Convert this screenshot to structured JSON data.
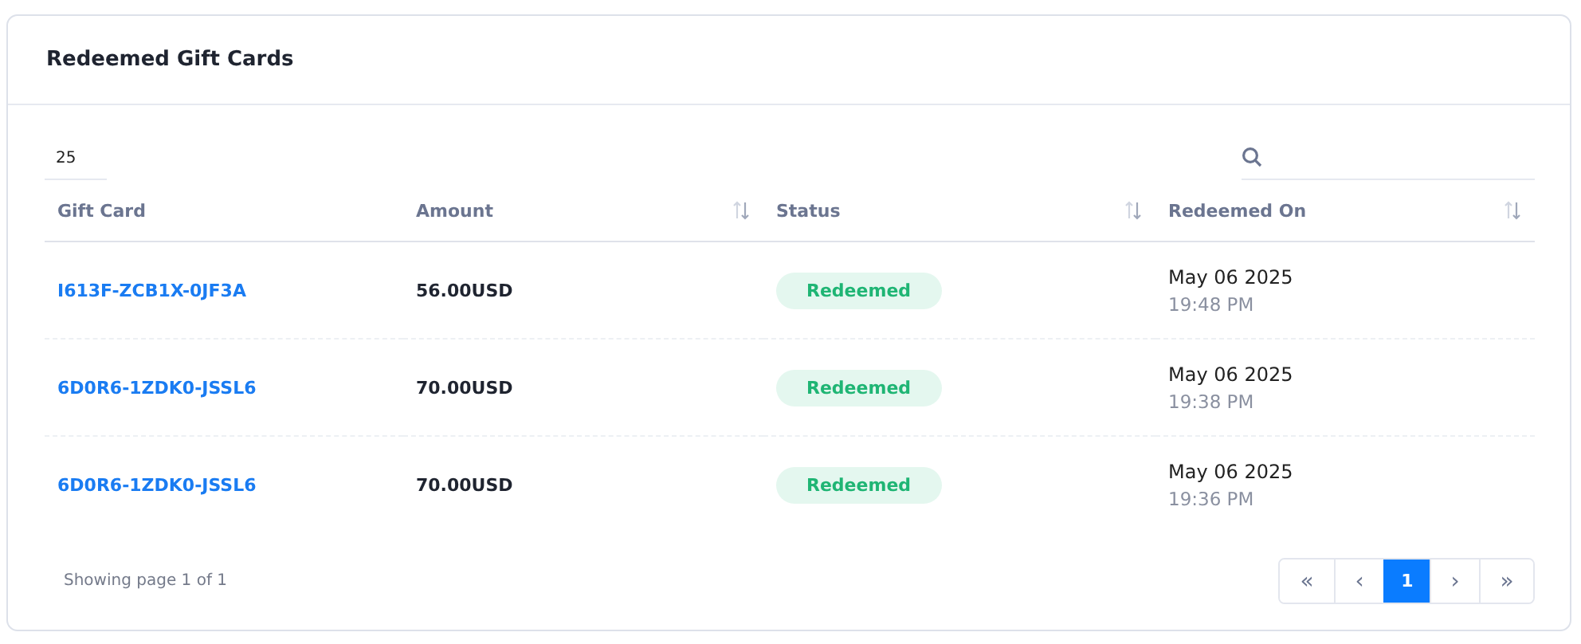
{
  "card": {
    "title": "Redeemed Gift Cards"
  },
  "page_size": {
    "value": "25"
  },
  "table": {
    "columns": [
      {
        "label": "Gift Card",
        "sortable": false
      },
      {
        "label": "Amount",
        "sortable": true
      },
      {
        "label": "Status",
        "sortable": true
      },
      {
        "label": "Redeemed On",
        "sortable": true
      }
    ],
    "rows": [
      {
        "gift_card": "I613F-ZCB1X-0JF3A",
        "amount": "56.00USD",
        "status": "Redeemed",
        "date": "May 06 2025",
        "time": "19:48 PM"
      },
      {
        "gift_card": "6D0R6-1ZDK0-JSSL6",
        "amount": "70.00USD",
        "status": "Redeemed",
        "date": "May 06 2025",
        "time": "19:38 PM"
      },
      {
        "gift_card": "6D0R6-1ZDK0-JSSL6",
        "amount": "70.00USD",
        "status": "Redeemed",
        "date": "May 06 2025",
        "time": "19:36 PM"
      }
    ]
  },
  "footer": {
    "info": "Showing page 1 of 1"
  },
  "pagination": [
    {
      "label": "«",
      "selected": false
    },
    {
      "label": "‹",
      "selected": false
    },
    {
      "label": "1",
      "selected": true
    },
    {
      "label": "›",
      "selected": false
    },
    {
      "label": "»",
      "selected": false
    }
  ]
}
